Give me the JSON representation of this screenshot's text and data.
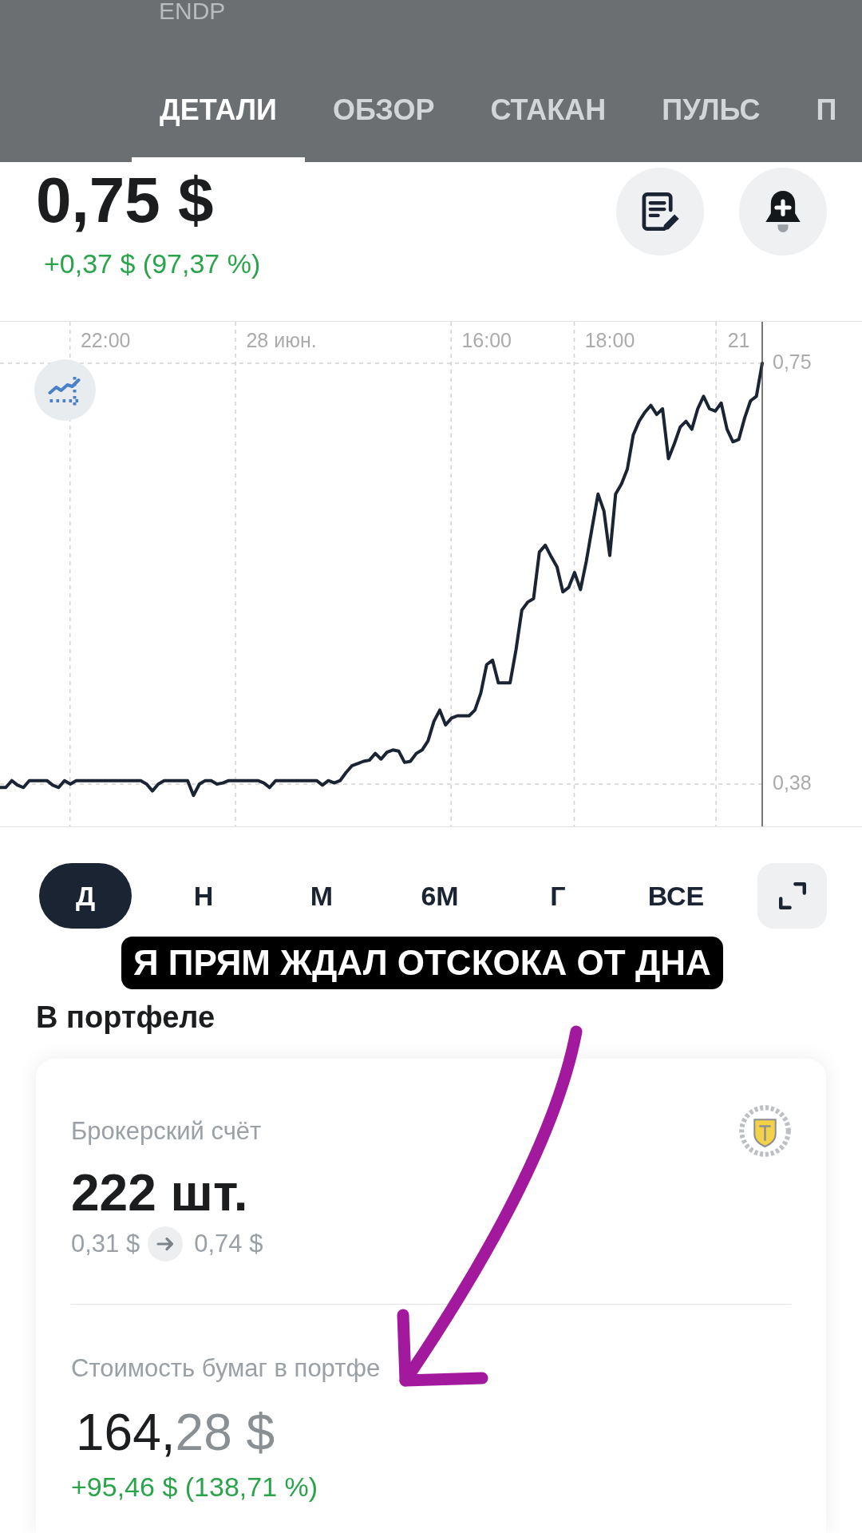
{
  "header": {
    "ticker": "ENDP",
    "tabs": [
      {
        "label": "ДЕТАЛИ",
        "selected": true
      },
      {
        "label": "ОБЗОР",
        "selected": false
      },
      {
        "label": "СТАКАН",
        "selected": false
      },
      {
        "label": "ПУЛЬС",
        "selected": false
      },
      {
        "label": "П",
        "selected": false
      }
    ]
  },
  "quote": {
    "price": "0,75 $",
    "change": "+0,37 $ (97,37 %)"
  },
  "chart": {
    "chart_data": {
      "type": "line",
      "categories": [
        null,
        null,
        null,
        null,
        null,
        null,
        null,
        null,
        null,
        null,
        null,
        null,
        null,
        null,
        null,
        null,
        null,
        null,
        "22:00",
        null,
        null,
        null,
        null,
        null,
        null,
        null,
        null,
        null,
        null,
        null,
        null,
        null,
        null,
        null,
        null,
        null,
        null,
        null,
        null,
        null,
        null,
        null,
        null,
        null,
        null,
        null,
        null,
        null,
        "28 июн.",
        null,
        null,
        null,
        null,
        null,
        null,
        null,
        null,
        null,
        null,
        null,
        null,
        null,
        null,
        null,
        null,
        null,
        null,
        null,
        null,
        null,
        null,
        null,
        null,
        null,
        null,
        null,
        null,
        null,
        null,
        null,
        null,
        null,
        null,
        "16:00",
        null,
        null,
        null,
        null,
        null,
        null,
        null,
        null,
        null,
        null,
        null,
        null,
        null,
        null,
        null,
        null,
        null,
        null,
        null,
        null,
        "18:00",
        null,
        null,
        null,
        null,
        null,
        null,
        null,
        null,
        null,
        null,
        null,
        null,
        null,
        null,
        null,
        null,
        null,
        null,
        null,
        null,
        null,
        "21",
        null,
        null,
        null,
        null
      ],
      "series": [
        {
          "color": "#1b2433",
          "values": [
            0.377,
            0.377,
            0.383,
            0.379,
            0.377,
            0.383,
            0.383,
            0.383,
            0.383,
            0.379,
            0.377,
            0.383,
            0.38,
            0.383,
            0.383,
            0.383,
            0.383,
            0.383,
            0.383,
            0.383,
            0.383,
            0.383,
            0.383,
            0.383,
            0.383,
            0.38,
            0.374,
            0.38,
            0.383,
            0.383,
            0.383,
            0.383,
            0.383,
            0.37,
            0.38,
            0.383,
            0.383,
            0.38,
            0.381,
            0.383,
            0.383,
            0.383,
            0.383,
            0.383,
            0.383,
            0.381,
            0.377,
            0.383,
            0.383,
            0.383,
            0.383,
            0.383,
            0.383,
            0.383,
            0.383,
            0.379,
            0.383,
            0.381,
            0.383,
            0.39,
            0.396,
            0.398,
            0.4,
            0.401,
            0.407,
            0.402,
            0.408,
            0.41,
            0.409,
            0.399,
            0.4,
            0.407,
            0.41,
            0.418,
            0.435,
            0.445,
            0.432,
            0.438,
            0.44,
            0.44,
            0.44,
            0.445,
            0.46,
            0.485,
            0.489,
            0.469,
            0.469,
            0.469,
            0.498,
            0.533,
            0.54,
            0.543,
            0.584,
            0.59,
            0.58,
            0.571,
            0.549,
            0.553,
            0.566,
            0.551,
            0.576,
            0.606,
            0.635,
            0.62,
            0.581,
            0.635,
            0.644,
            0.657,
            0.687,
            0.699,
            0.707,
            0.713,
            0.705,
            0.71,
            0.666,
            0.679,
            0.694,
            0.699,
            0.692,
            0.71,
            0.721,
            0.71,
            0.708,
            0.715,
            0.692,
            0.681,
            0.683,
            0.702,
            0.717,
            0.721,
            0.75
          ]
        }
      ],
      "ylim": [
        0.3428,
        0.7865
      ],
      "yticks": [
        {
          "value": 0.75,
          "label": "0,75"
        },
        {
          "value": 0.38,
          "label": "0,38"
        }
      ]
    }
  },
  "periods": [
    {
      "label": "Д",
      "selected": true
    },
    {
      "label": "Н",
      "selected": false
    },
    {
      "label": "М",
      "selected": false
    },
    {
      "label": "6М",
      "selected": false
    },
    {
      "label": "Г",
      "selected": false
    },
    {
      "label": "ВСЕ",
      "selected": false
    }
  ],
  "caption": "Я ПРЯМ ЖДАЛ ОТСКОКА ОТ ДНА",
  "portfolio": {
    "title": "В портфеле",
    "account": "Брокерский счёт",
    "quantity": "222 шт.",
    "buy_price": "0,31 $",
    "current_price": "0,74 $",
    "value_label": "Стоимость бумаг в портфе",
    "value_whole": "164,",
    "value_rest": "28 $",
    "gain": "+95,46 $ (138,71 %)"
  }
}
